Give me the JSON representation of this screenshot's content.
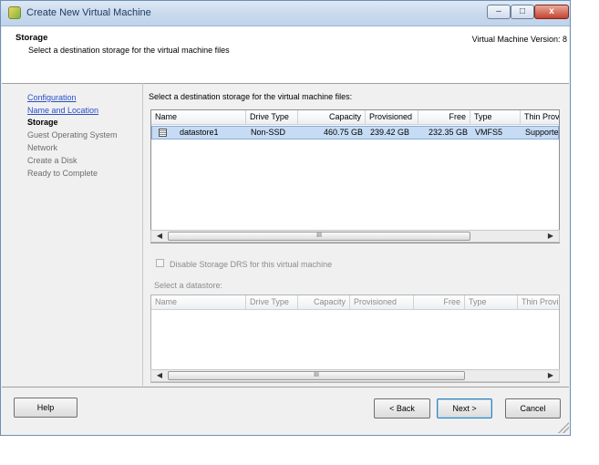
{
  "window": {
    "title": "Create New Virtual Machine",
    "minimize_glyph": "–",
    "maximize_glyph": "□",
    "close_glyph": "x"
  },
  "header": {
    "title": "Storage",
    "subtitle": "Select a destination storage for the virtual machine files",
    "version": "Virtual Machine Version: 8"
  },
  "nav": {
    "items": [
      {
        "label": "Configuration",
        "state": "link"
      },
      {
        "label": "Name and Location",
        "state": "link"
      },
      {
        "label": "Storage",
        "state": "current"
      },
      {
        "label": "Guest Operating System",
        "state": "pending"
      },
      {
        "label": "Network",
        "state": "pending"
      },
      {
        "label": "Create a Disk",
        "state": "pending"
      },
      {
        "label": "Ready to Complete",
        "state": "pending"
      }
    ]
  },
  "main": {
    "prompt": "Select a destination storage for the virtual machine files:",
    "table": {
      "columns": [
        "Name",
        "Drive Type",
        "Capacity",
        "Provisioned",
        "Free",
        "Type",
        "Thin Prov"
      ],
      "rows": [
        {
          "icon": "datastore-icon",
          "name": "datastore1",
          "drive_type": "Non-SSD",
          "capacity": "460.75 GB",
          "provisioned": "239.42 GB",
          "free": "232.35 GB",
          "type": "VMFS5",
          "thin": "Supporte"
        }
      ]
    },
    "scroll_thumb_glyph": "III",
    "disable_drs_label": "Disable Storage DRS for this virtual machine",
    "select_datastore_label": "Select a datastore:",
    "table2": {
      "columns": [
        "Name",
        "Drive Type",
        "Capacity",
        "Provisioned",
        "Free",
        "Type",
        "Thin Provi"
      ]
    }
  },
  "footer": {
    "help": "Help",
    "back": "< Back",
    "next": "Next >",
    "cancel": "Cancel"
  },
  "colors": {
    "selected_row": "#c6dcf4",
    "link": "#2a4fc8"
  }
}
